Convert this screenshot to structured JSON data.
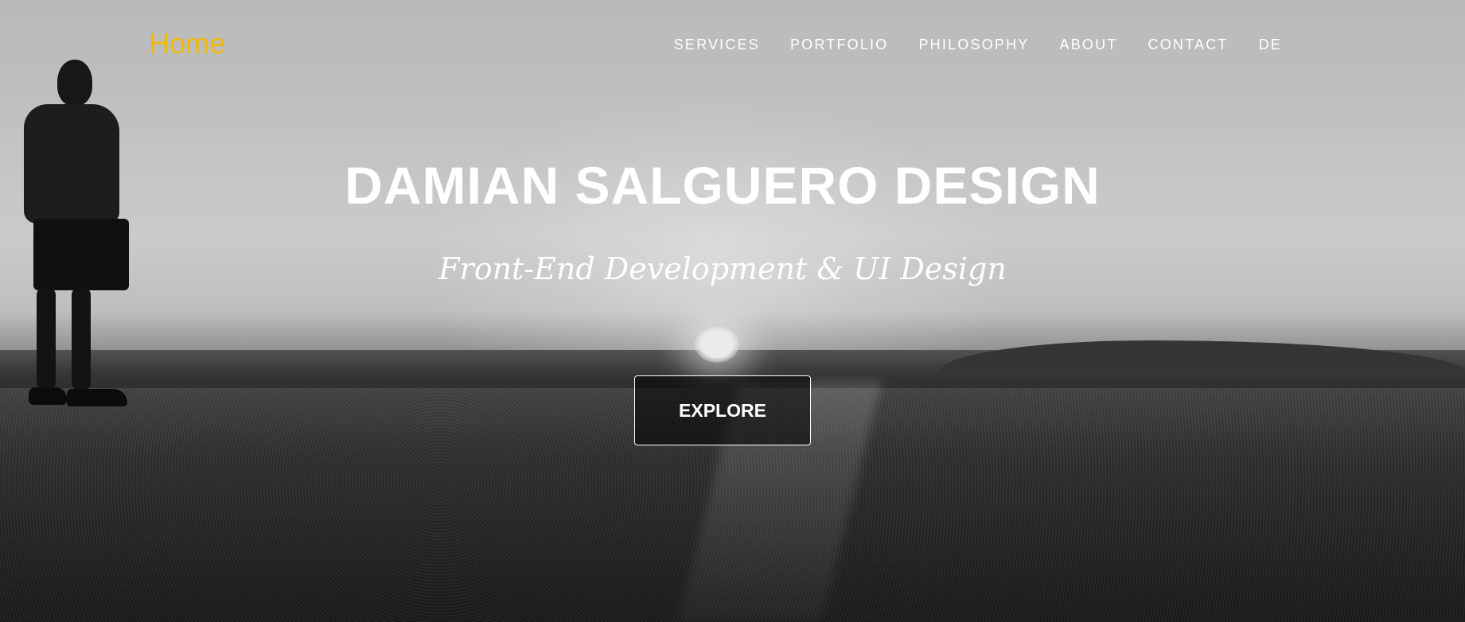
{
  "nav": {
    "brand": "Home",
    "links": [
      {
        "label": "SERVICES"
      },
      {
        "label": "PORTFOLIO"
      },
      {
        "label": "PHILOSOPHY"
      },
      {
        "label": "ABOUT"
      },
      {
        "label": "CONTACT"
      },
      {
        "label": "DE"
      }
    ]
  },
  "hero": {
    "title": "DAMIAN SALGUERO DESIGN",
    "subtitle": "Front-End Development & UI Design",
    "cta_label": "EXPLORE"
  },
  "colors": {
    "brand": "#f0b90b",
    "text": "#ffffff"
  }
}
